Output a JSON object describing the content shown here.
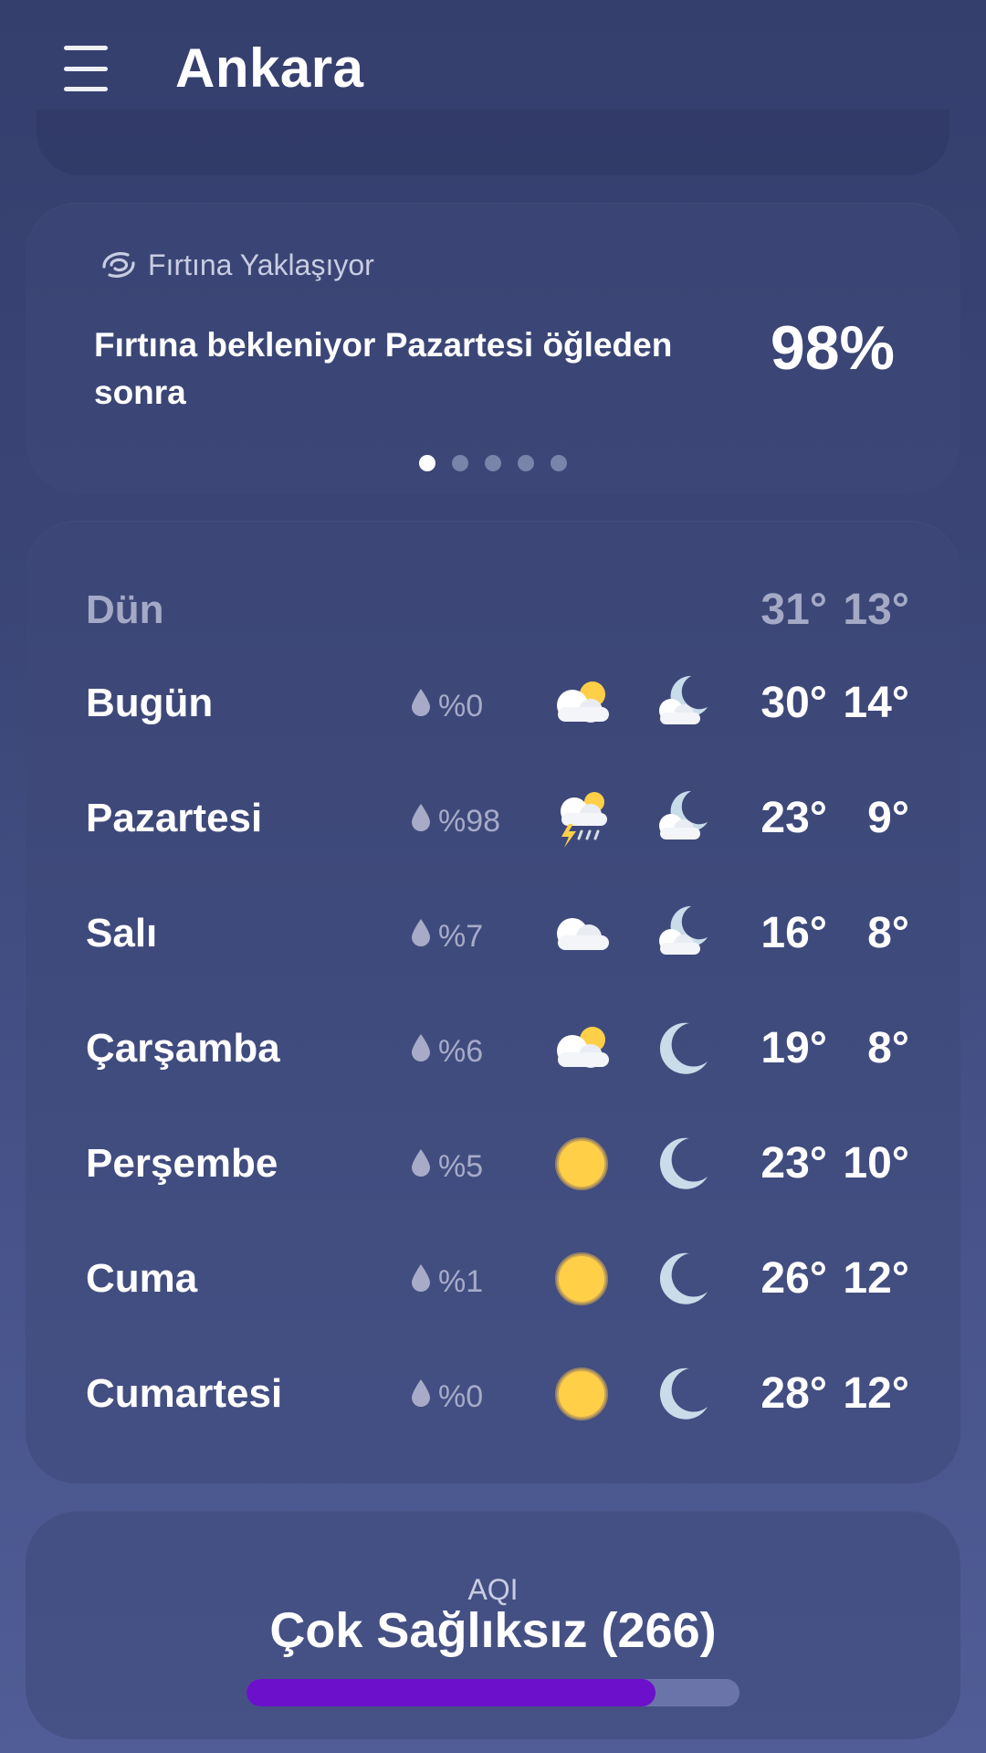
{
  "header": {
    "menu_icon": "hamburger-menu-icon",
    "city": "Ankara"
  },
  "storm": {
    "title": "Fırtına Yaklaşıyor",
    "icon": "storm-swirl-icon",
    "message": "Fırtına bekleniyor Pazartesi öğleden sonra",
    "probability": "98%",
    "pager": {
      "count": 5,
      "active_index": 0
    }
  },
  "forecast": {
    "yesterday": {
      "day": "Dün",
      "high": "31°",
      "low": "13°"
    },
    "days": [
      {
        "day": "Bugün",
        "precip": "%0",
        "day_icon": "partly-cloudy-day-icon",
        "night_icon": "partly-cloudy-night-icon",
        "high": "30°",
        "low": "14°"
      },
      {
        "day": "Pazartesi",
        "precip": "%98",
        "day_icon": "thunderstorm-icon",
        "night_icon": "partly-cloudy-night-icon",
        "high": "23°",
        "low": "9°"
      },
      {
        "day": "Salı",
        "precip": "%7",
        "day_icon": "cloudy-icon",
        "night_icon": "partly-cloudy-night-icon",
        "high": "16°",
        "low": "8°"
      },
      {
        "day": "Çarşamba",
        "precip": "%6",
        "day_icon": "partly-cloudy-day-icon",
        "night_icon": "moon-icon",
        "high": "19°",
        "low": "8°"
      },
      {
        "day": "Perşembe",
        "precip": "%5",
        "day_icon": "sun-icon",
        "night_icon": "moon-icon",
        "high": "23°",
        "low": "10°"
      },
      {
        "day": "Cuma",
        "precip": "%1",
        "day_icon": "sun-icon",
        "night_icon": "moon-icon",
        "high": "26°",
        "low": "12°"
      },
      {
        "day": "Cumartesi",
        "precip": "%0",
        "day_icon": "sun-icon",
        "night_icon": "moon-icon",
        "high": "28°",
        "low": "12°"
      }
    ]
  },
  "aqi": {
    "label": "AQI",
    "value": "Çok Sağlıksız (266)",
    "level_fraction": 0.83
  },
  "colors": {
    "background_top": "#353f6e",
    "background_bottom": "#505d96",
    "sun": "#ffcf48",
    "moon": "#c8dcea",
    "aqi_fill": "#6c10cc",
    "aqi_track": "#6b74a8"
  }
}
